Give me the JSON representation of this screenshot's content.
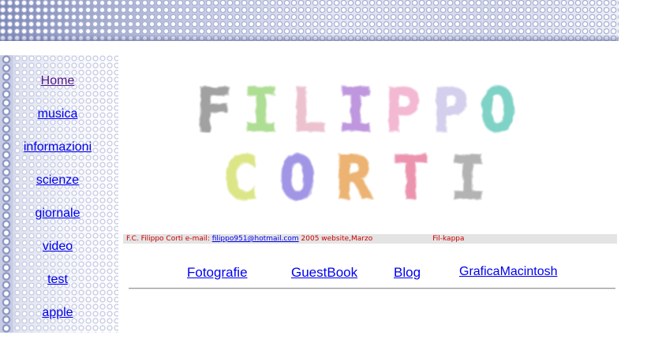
{
  "nav": {
    "items": [
      {
        "label": "Home",
        "visited": true
      },
      {
        "label": "musica"
      },
      {
        "label": "informazioni"
      },
      {
        "label": "scienze"
      },
      {
        "label": "giornale"
      },
      {
        "label": "video"
      },
      {
        "label": "test"
      },
      {
        "label": "apple"
      }
    ]
  },
  "logo": {
    "line1": "FILIPPO",
    "line2": "CORTI",
    "colors": [
      "#8a8a8a",
      "#9ad67a",
      "#e8b3c4",
      "#b07ed6",
      "#f0a8c8",
      "#c9c4e8",
      "#5ec7b8",
      "#d4e06a",
      "#8a7ce0",
      "#e8a050",
      "#e87a9a",
      "#a0a0a0"
    ]
  },
  "info_bar": {
    "prefix": "F.C. Filippo Corti e-mail: ",
    "email": "filippo951@hotmail.com",
    "suffix": " 2005 website,Marzo",
    "right": "Fil-kappa"
  },
  "bottom_links": [
    "Fotografie",
    "GuestBook",
    "Blog",
    "GraficaMacintosh"
  ],
  "colors": {
    "link": "#0000ee",
    "visited": "#551a8b",
    "info_text": "#cc0000"
  }
}
